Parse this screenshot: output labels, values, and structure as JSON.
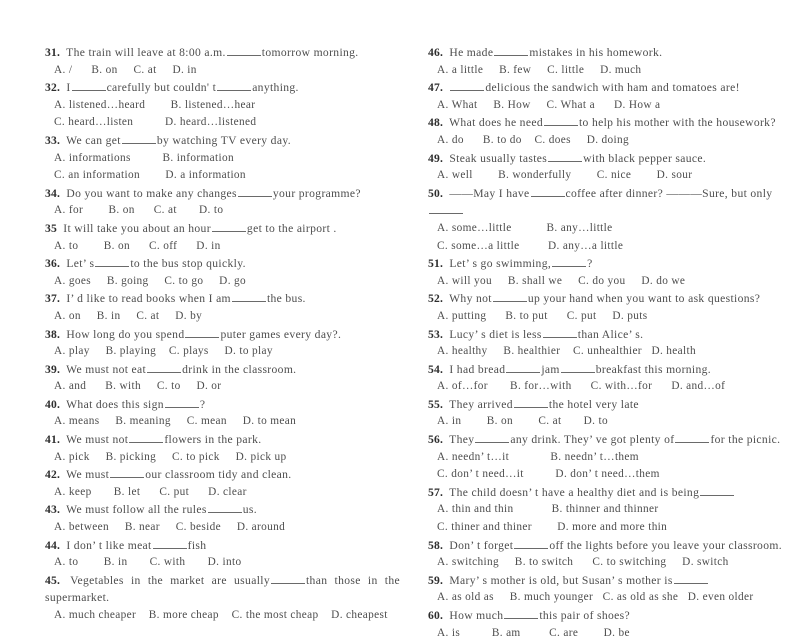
{
  "document": {
    "type": "english-grammar-multiple-choice-worksheet",
    "question_range": "31-60",
    "columns": 2
  },
  "left_column": [
    {
      "number": "31.",
      "stem_before": "The train will leave at 8:00 a.m.",
      "blank": true,
      "stem_after": "tomorrow morning.",
      "option_lines": [
        "A. /      B. on     C. at     D. in"
      ]
    },
    {
      "number": "32.",
      "stem_before": "I",
      "blank": true,
      "stem_after": "carefully but couldn' t",
      "blank2": true,
      "stem_after2": "anything.",
      "option_lines": [
        "A. listened…heard        B. listened…hear",
        "C. heard…listen          D. heard…listened"
      ]
    },
    {
      "number": "33.",
      "stem_before": "We can get",
      "blank": true,
      "stem_after": "by watching TV every day.",
      "option_lines": [
        "A. informations          B. information",
        "C. an information        D. a information"
      ]
    },
    {
      "number": "34.",
      "stem_before": "Do you want to make any changes",
      "blank": true,
      "stem_after": "your programme?",
      "option_lines": [
        "A. for        B. on      C. at       D. to"
      ]
    },
    {
      "number": "35",
      "stem_before": "It will take you about an hour",
      "blank": true,
      "stem_after": "get to the airport .",
      "option_lines": [
        "A. to        B. on      C. off      D. in"
      ]
    },
    {
      "number": "36.",
      "stem_before": "Let’ s",
      "blank": true,
      "stem_after": "to the bus stop quickly.",
      "option_lines": [
        "A. goes     B. going     C. to go     D. go"
      ]
    },
    {
      "number": "37.",
      "stem_before": "I’ d like to read books when I am",
      "blank": true,
      "stem_after": "the bus.",
      "option_lines": [
        "A. on     B. in     C. at     D. by"
      ]
    },
    {
      "number": "38.",
      "stem_before": "How long do you spend",
      "blank": true,
      "stem_after": "puter games every day?.",
      "option_lines": [
        "A. play     B. playing    C. plays     D. to play"
      ]
    },
    {
      "number": "39.",
      "stem_before": "We must not eat",
      "blank": true,
      "stem_after": "drink in the classroom.",
      "option_lines": [
        "A. and      B. with     C. to     D. or"
      ]
    },
    {
      "number": "40.",
      "stem_before": "What does this sign",
      "blank": true,
      "stem_after": "?",
      "option_lines": [
        "A. means     B. meaning     C. mean     D. to mean"
      ]
    },
    {
      "number": "41.",
      "stem_before": "We must not",
      "blank": true,
      "stem_after": "flowers in the park.",
      "option_lines": [
        "A. pick     B. picking     C. to pick     D. pick up"
      ]
    },
    {
      "number": "42.",
      "stem_before": "We must",
      "blank": true,
      "stem_after": "our classroom tidy and clean.",
      "option_lines": [
        "A. keep       B. let      C. put      D. clear"
      ]
    },
    {
      "number": "43.",
      "stem_before": "We must follow all the rules",
      "blank": true,
      "stem_after": "us.",
      "option_lines": [
        "A. between     B. near     C. beside     D. around"
      ]
    },
    {
      "number": "44.",
      "stem_before": "I don’ t like meat",
      "blank": true,
      "stem_after": "fish",
      "option_lines": [
        "A. to        B. in       C. with       D. into"
      ]
    },
    {
      "number": "45.",
      "stem_before": "Vegetables in the market are usually",
      "blank": true,
      "stem_after": "than those in the supermarket.",
      "justify": true,
      "option_lines": [
        "A. much cheaper    B. more cheap    C. the most cheap    D. cheapest"
      ]
    }
  ],
  "right_column": [
    {
      "number": "46.",
      "stem_before": "He made",
      "blank": true,
      "stem_after": "mistakes in his homework.",
      "option_lines": [
        "A. a little     B. few     C. little     D. much"
      ]
    },
    {
      "number": "47.",
      "stem_before": "",
      "blank": true,
      "stem_after": "delicious the sandwich with ham and tomatoes are!",
      "option_lines": [
        "A. What     B. How     C. What a      D. How a"
      ]
    },
    {
      "number": "48.",
      "stem_before": "What does he need",
      "blank": true,
      "stem_after": "to help his mother with the housework?",
      "option_lines": [
        "A. do      B. to do    C. does     D. doing"
      ]
    },
    {
      "number": "49.",
      "stem_before": "Steak usually tastes",
      "blank": true,
      "stem_after": "with black pepper sauce.",
      "option_lines": [
        "A. well        B. wonderfully        C. nice        D. sour"
      ]
    },
    {
      "number": "50.",
      "stem_before": "——May I have",
      "blank": true,
      "stem_after": "coffee after dinner? ———Sure, but only",
      "blank2": true,
      "stem_after2": "",
      "option_lines": [
        "A. some…little           B. any…little",
        "C. some…a little         D. any…a little"
      ]
    },
    {
      "number": "51.",
      "stem_before": "Let’ s go swimming,",
      "blank": true,
      "stem_after": "?",
      "option_lines": [
        "A. will you     B. shall we     C. do you     D. do we"
      ]
    },
    {
      "number": "52.",
      "stem_before": "Why not",
      "blank": true,
      "stem_after": "up your hand when you want to ask questions?",
      "option_lines": [
        "A. putting      B. to put      C. put     D. puts"
      ]
    },
    {
      "number": "53.",
      "stem_before": "Lucy’ s diet is less",
      "blank": true,
      "stem_after": "than Alice’ s.",
      "option_lines": [
        "A. healthy     B. healthier    C. unhealthier   D. health"
      ]
    },
    {
      "number": "54.",
      "stem_before": "I had bread",
      "blank": true,
      "stem_after": "jam",
      "blank2": true,
      "stem_after2": "breakfast this morning.",
      "option_lines": [
        "A. of…for       B. for…with      C. with…for      D. and…of"
      ]
    },
    {
      "number": "55.",
      "stem_before": "They arrived",
      "blank": true,
      "stem_after": "the hotel very late",
      "option_lines": [
        "A. in        B. on        C. at       D. to"
      ]
    },
    {
      "number": "56.",
      "stem_before": "They",
      "blank": true,
      "stem_after": "any drink. They’ ve got plenty of",
      "blank2": true,
      "stem_after2": "for the picnic.",
      "option_lines": [
        "A. needn’ t…it             B. needn’ t…them",
        "C. don’ t need…it          D. don’ t need…them"
      ]
    },
    {
      "number": "57.",
      "stem_before": "The child doesn’ t have a healthy diet and is being",
      "blank": true,
      "stem_after": "",
      "option_lines": [
        "A. thin and thin            B. thinner and thinner",
        "C. thiner and thiner        D. more and more thin"
      ]
    },
    {
      "number": "58.",
      "stem_before": "Don’ t forget",
      "blank": true,
      "stem_after": "off the lights before you leave your classroom.",
      "option_lines": [
        "A. switching     B. to switch      C. to switching     D. switch"
      ]
    },
    {
      "number": "59.",
      "stem_before": "Mary’ s mother is old, but Susan’ s mother is",
      "blank": true,
      "stem_after": "",
      "option_lines": [
        "A. as old as     B. much younger   C. as old as she   D. even older"
      ]
    },
    {
      "number": "60.",
      "stem_before": "How much",
      "blank": true,
      "stem_after": "this pair of shoes?",
      "option_lines": [
        "A. is          B. am         C. are        D. be"
      ]
    }
  ]
}
